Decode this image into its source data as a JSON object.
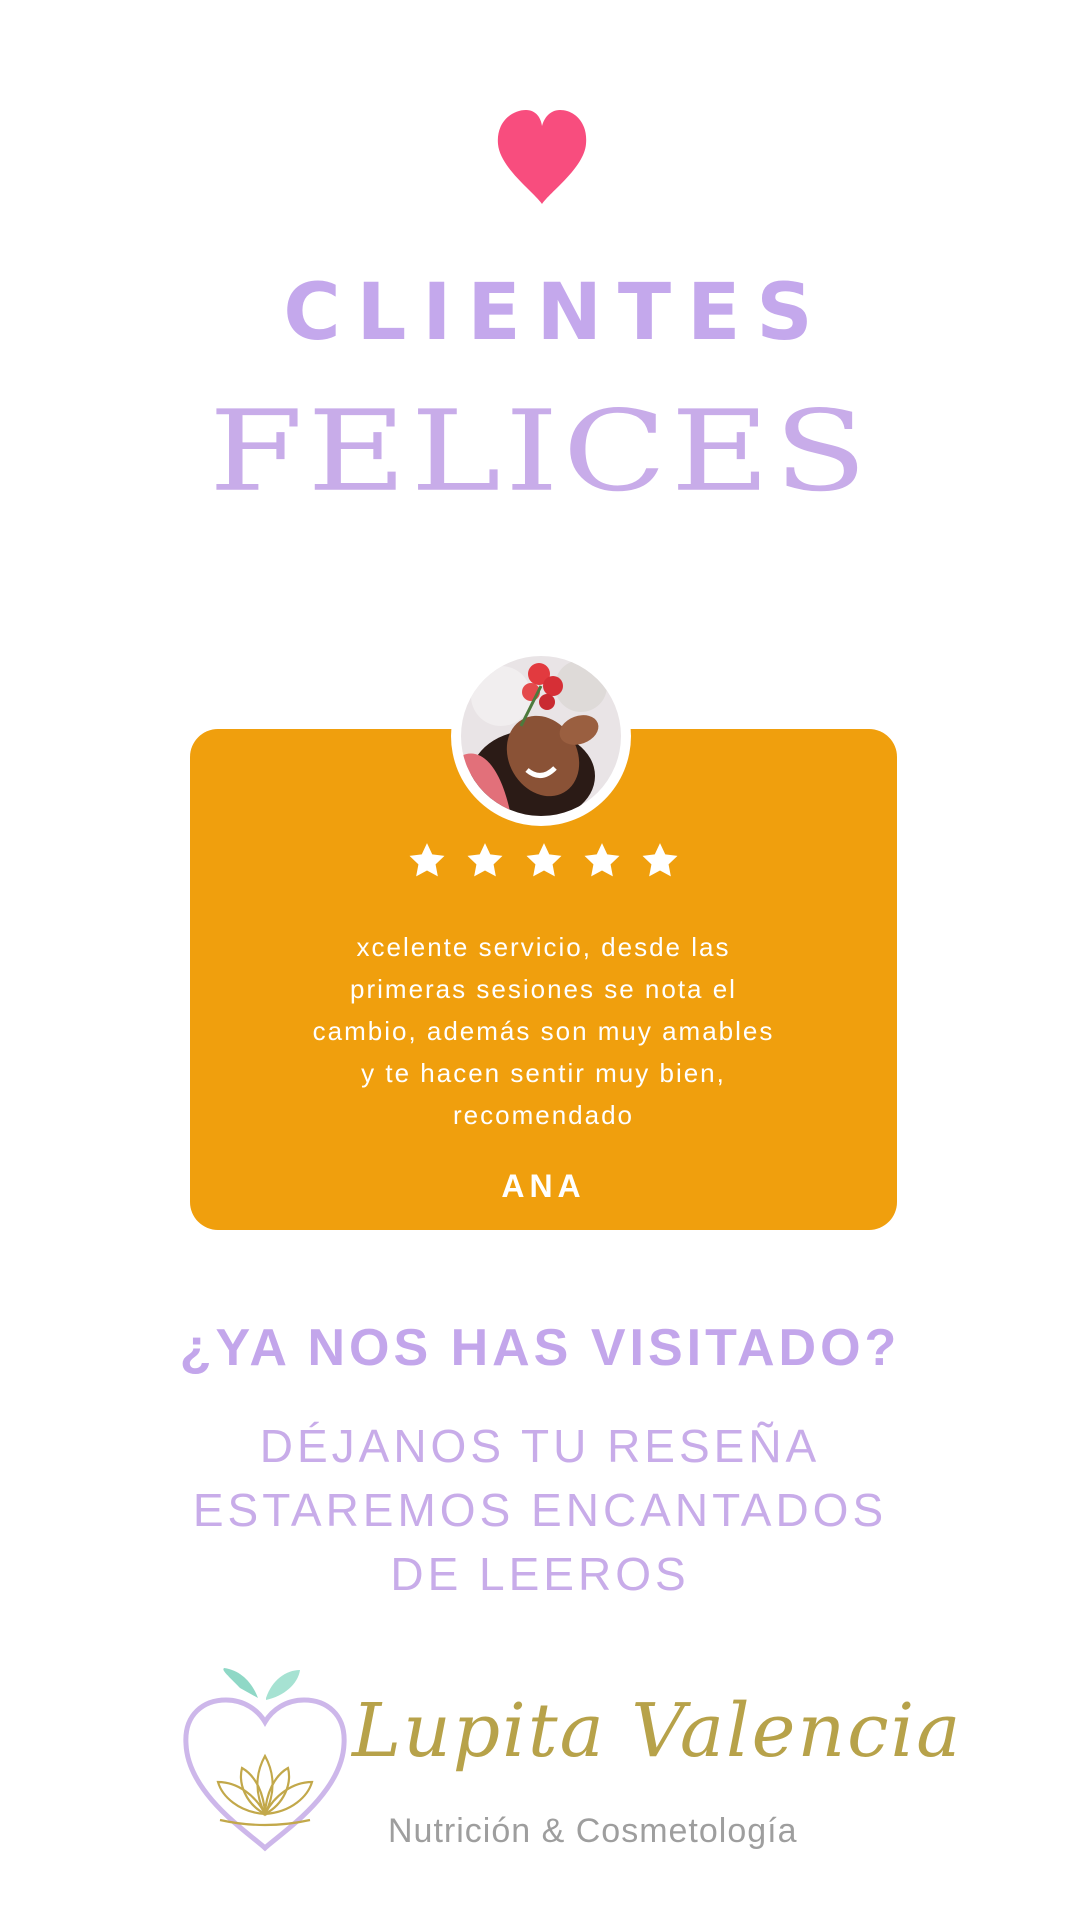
{
  "header": {
    "title_top": "CLIENTES",
    "title_bottom": "FELICES"
  },
  "review": {
    "rating": 5,
    "rating_max": 5,
    "quote_lines": [
      "xcelente servicio, desde las",
      "primeras sesiones se nota el",
      "cambio, además son muy amables",
      "y te hacen sentir muy bien,",
      "recomendado"
    ],
    "reviewer": "ANA"
  },
  "cta": {
    "question": "¿YA NOS HAS VISITADO?",
    "lines": [
      "DÉJANOS TU RESEÑA",
      "ESTAREMOS ENCANTADOS",
      "DE LEEROS"
    ]
  },
  "brand": {
    "name": "Lupita Valencia",
    "subtitle": "Nutrición & Cosmetología"
  },
  "colors": {
    "accent_purple": "#c4a8ec",
    "card_orange": "#f09f0d",
    "heart_pink": "#f84d7e",
    "brand_gold": "#b7a24a"
  },
  "icons": [
    "heart-icon",
    "star-icon",
    "lotus-heart-logo-icon"
  ]
}
